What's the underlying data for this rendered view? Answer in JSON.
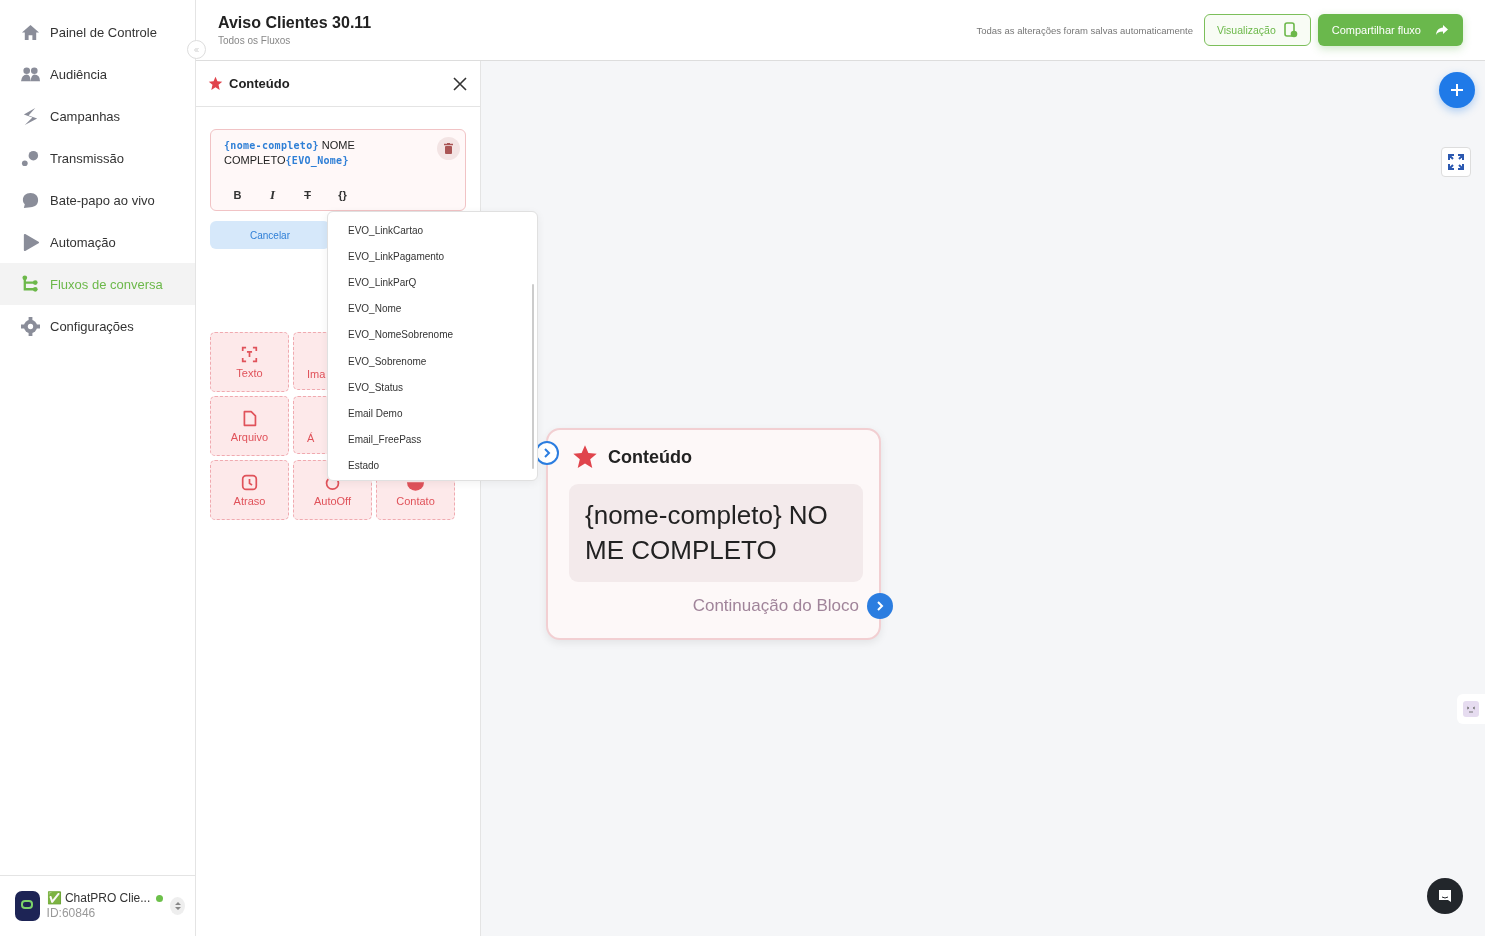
{
  "sidebar": {
    "items": [
      {
        "label": "Painel de Controle",
        "selected": false
      },
      {
        "label": "Audiência",
        "selected": false
      },
      {
        "label": "Campanhas",
        "selected": false
      },
      {
        "label": "Transmissão",
        "selected": false
      },
      {
        "label": "Bate-papo ao vivo",
        "selected": false
      },
      {
        "label": "Automação",
        "selected": false
      },
      {
        "label": "Fluxos de conversa",
        "selected": true
      },
      {
        "label": "Configurações",
        "selected": false
      }
    ],
    "account": {
      "name": "✅ ChatPRO Clie...",
      "id": "ID:60846",
      "online": true
    }
  },
  "header": {
    "title": "Aviso Clientes 30.11",
    "breadcrumb": "Todos os Fluxos",
    "save_status": "Todas as alterações foram salvas automaticamente",
    "preview_button": "Visualização",
    "share_button": "Compartilhar fluxo"
  },
  "panel": {
    "title": "Conteúdo",
    "editor": {
      "segments": [
        {
          "kind": "variable",
          "text": "{nome-completo}"
        },
        {
          "kind": "text",
          "text": " NOME COMPLETO"
        },
        {
          "kind": "variable",
          "text": "{EVO_Nome}"
        }
      ],
      "toolbar": [
        "B",
        "I",
        "T",
        "{}"
      ]
    },
    "cancel_button": "Cancelar",
    "tile_rows": [
      [
        {
          "label": "Texto"
        },
        {
          "label": "Ima"
        }
      ],
      [
        {
          "label": "Arquivo"
        },
        {
          "label": "Á"
        }
      ],
      [
        {
          "label": "Atraso"
        },
        {
          "label": "AutoOff"
        },
        {
          "label": "Contato"
        }
      ]
    ],
    "variable_menu": [
      "EVO_LinkCartao",
      "EVO_LinkPagamento",
      "EVO_LinkParQ",
      "EVO_Nome",
      "EVO_NomeSobrenome",
      "EVO_Sobrenome",
      "EVO_Status",
      "Email Demo",
      "Email_FreePass",
      "Estado"
    ]
  },
  "canvas": {
    "node": {
      "title": "Conteúdo",
      "message": "{nome-completo} NOME COMPLETO",
      "continuation": "Continuação do Bloco"
    }
  }
}
